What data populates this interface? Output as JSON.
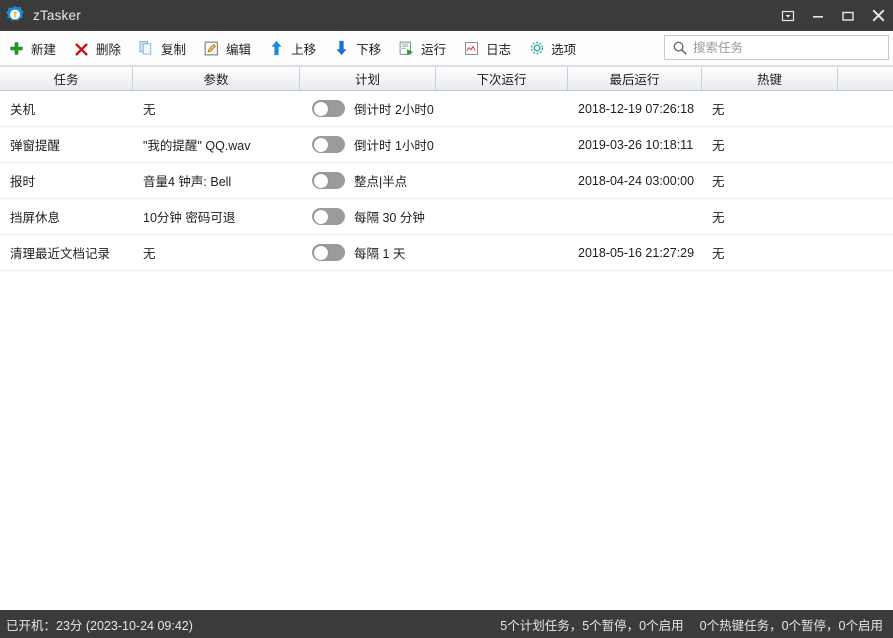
{
  "window": {
    "title": "zTasker",
    "app_icon": "gear-t-logo-icon",
    "controls": [
      {
        "name": "restore-down-button",
        "icon": "boxed-chevron-down-icon"
      },
      {
        "name": "minimize-button",
        "icon": "minimize-icon"
      },
      {
        "name": "maximize-button",
        "icon": "maximize-icon"
      },
      {
        "name": "close-button",
        "icon": "close-icon"
      }
    ]
  },
  "toolbar": {
    "items": [
      {
        "label": "新建",
        "icon": "plus-icon"
      },
      {
        "label": "删除",
        "icon": "cross-delete-icon"
      },
      {
        "label": "复制",
        "icon": "copy-pages-icon"
      },
      {
        "label": "编辑",
        "icon": "pencil-edit-icon"
      },
      {
        "label": "上移",
        "icon": "arrow-up-icon"
      },
      {
        "label": "下移",
        "icon": "arrow-down-icon"
      },
      {
        "label": "运行",
        "icon": "run-play-icon"
      },
      {
        "label": "日志",
        "icon": "log-chart-icon"
      },
      {
        "label": "选项",
        "icon": "gear-options-icon"
      }
    ]
  },
  "search": {
    "placeholder": "搜索任务",
    "value": "",
    "icon": "search-icon"
  },
  "table": {
    "columns": [
      "任务",
      "参数",
      "计划",
      "下次运行",
      "最后运行",
      "热键"
    ],
    "rows": [
      {
        "task": "关机",
        "param": "无",
        "enabled": false,
        "plan": "倒计时 2小时0",
        "next_run": "",
        "last_run": "2018-12-19 07:26:18",
        "hotkey": "无"
      },
      {
        "task": "弹窗提醒",
        "param": "\"我的提醒\" QQ.wav",
        "enabled": false,
        "plan": "倒计时 1小时0",
        "next_run": "",
        "last_run": "2019-03-26 10:18:11",
        "hotkey": "无"
      },
      {
        "task": "报时",
        "param": "音量4 钟声: Bell",
        "enabled": false,
        "plan": "整点|半点",
        "next_run": "",
        "last_run": "2018-04-24 03:00:00",
        "hotkey": "无"
      },
      {
        "task": "挡屏休息",
        "param": "10分钟 密码可退",
        "enabled": false,
        "plan": "每隔 30 分钟",
        "next_run": "",
        "last_run": "",
        "hotkey": "无"
      },
      {
        "task": "清理最近文档记录",
        "param": "无",
        "enabled": false,
        "plan": "每隔 1 天",
        "next_run": "",
        "last_run": "2018-05-16 21:27:29",
        "hotkey": "无"
      }
    ]
  },
  "status": {
    "uptime": "已开机：23分 (2023-10-24 09:42)",
    "scheduled_summary": "5个计划任务，5个暂停，0个启用",
    "hotkey_summary": "0个热键任务，0个暂停，0个启用"
  },
  "colors": {
    "titlebar": "#3b3b3b",
    "accent_blue": "#1a8fd8",
    "accent_green": "#1a9b1a",
    "accent_red": "#cc1111",
    "toggle_off": "#9b9b9b"
  }
}
